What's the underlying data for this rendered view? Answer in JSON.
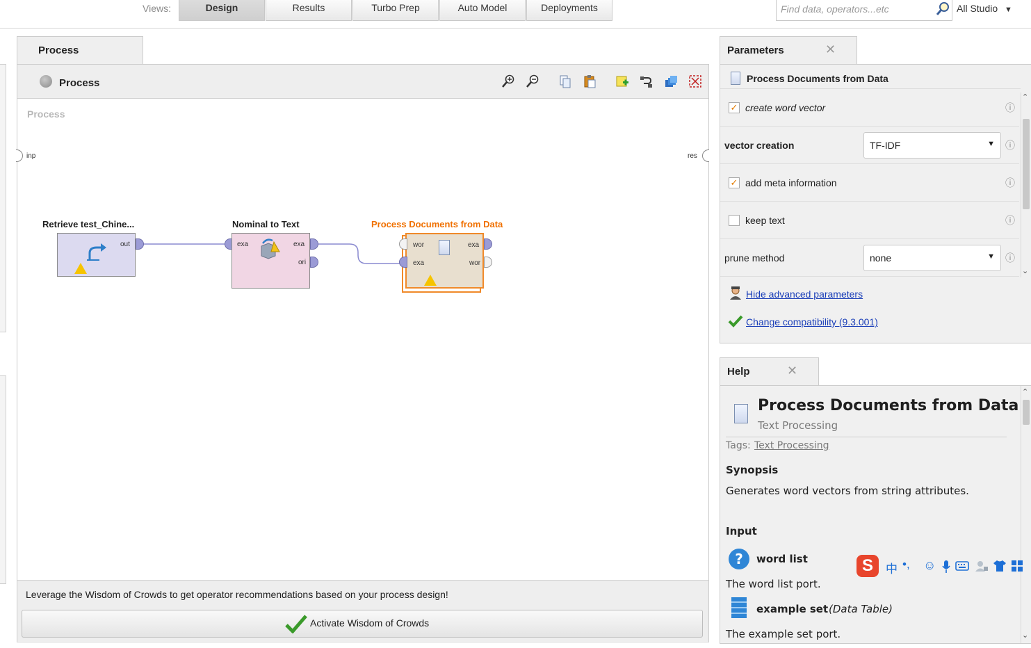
{
  "views": {
    "label": "Views:",
    "tabs": [
      "Design",
      "Results",
      "Turbo Prep",
      "Auto Model",
      "Deployments"
    ],
    "active": "Design"
  },
  "search": {
    "placeholder": "Find data, operators...etc",
    "scope": "All Studio"
  },
  "process_panel": {
    "tab_label": "Process",
    "header_title": "Process",
    "canvas_label": "Process",
    "left_port": "inp",
    "right_port": "res",
    "operators": [
      {
        "title": "Retrieve test_Chine...",
        "ports_out": [
          "out"
        ],
        "warning": true
      },
      {
        "title": "Nominal to Text",
        "ports_in": [
          "exa"
        ],
        "ports_out": [
          "exa",
          "ori"
        ],
        "warning": false
      },
      {
        "title": "Process Documents from Data",
        "ports_in": [
          "wor",
          "exa"
        ],
        "ports_out": [
          "exa",
          "wor"
        ],
        "warning": true,
        "selected": true
      }
    ],
    "wisdom_text": "Leverage the Wisdom of Crowds to get operator recommendations based on your process design!",
    "wisdom_button": "Activate Wisdom of Crowds"
  },
  "parameters": {
    "tab_label": "Parameters",
    "operator_name": "Process Documents from Data",
    "rows": [
      {
        "label": "create word vector",
        "type": "checkbox",
        "checked": true
      },
      {
        "label": "vector creation",
        "type": "select",
        "value": "TF-IDF"
      },
      {
        "label": "add meta information",
        "type": "checkbox",
        "checked": true
      },
      {
        "label": "keep text",
        "type": "checkbox",
        "checked": false
      },
      {
        "label": "prune method",
        "type": "select",
        "value": "none"
      }
    ],
    "hide_advanced": "Hide advanced parameters",
    "compatibility": "Change compatibility (9.3.001)"
  },
  "help": {
    "tab_label": "Help",
    "title": "Process Documents from Data",
    "category": "Text Processing",
    "tags_label": "Tags:",
    "tag": "Text Processing",
    "synopsis_heading": "Synopsis",
    "synopsis": "Generates word vectors from string attributes.",
    "input_heading": "Input",
    "inputs": [
      {
        "name": "word list",
        "type": "",
        "desc": "The word list port."
      },
      {
        "name": "example set",
        "type": "(Data Table)",
        "desc": "The example set port."
      }
    ]
  },
  "ime_toolbar": {
    "lang": "中",
    "punct": "•,"
  }
}
